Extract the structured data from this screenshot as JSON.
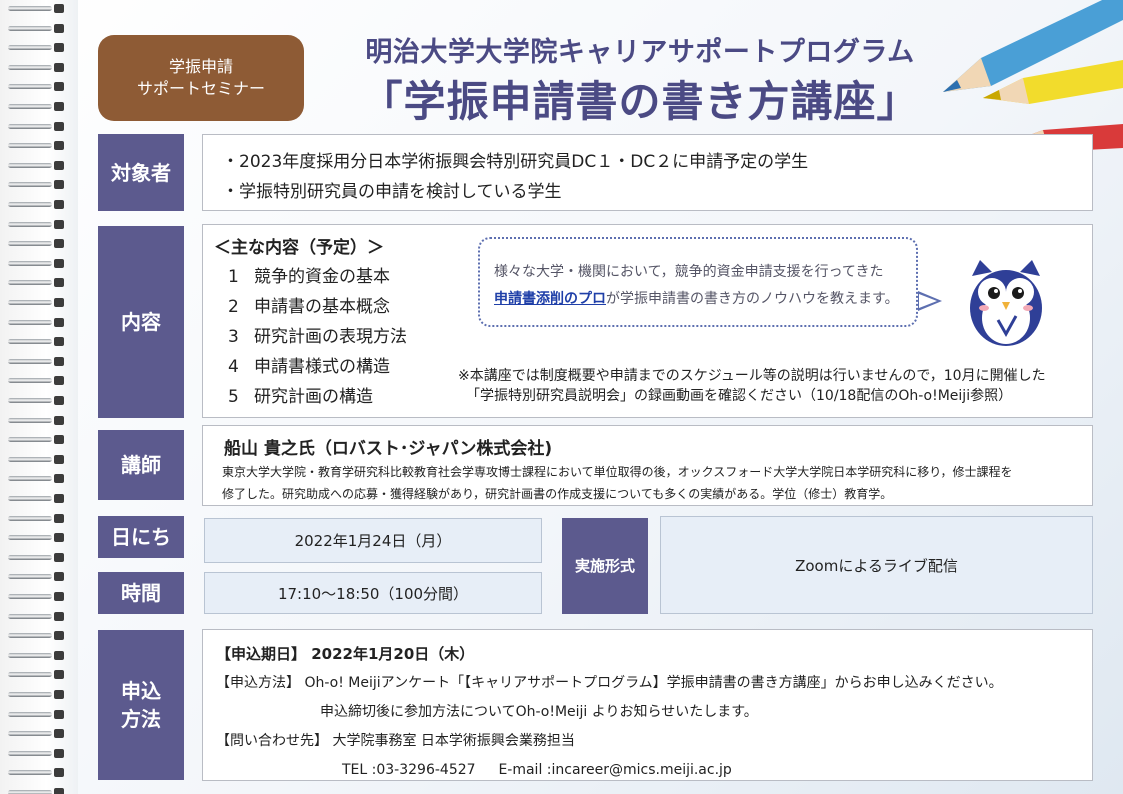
{
  "header": {
    "badge_line1": "学振申請",
    "badge_line2": "サポートセミナー",
    "subtitle": "明治大学大学院キャリアサポートプログラム",
    "title": "「学振申請書の書き方講座」"
  },
  "target": {
    "label": "対象者",
    "lines": [
      "・2023年度採用分日本学術振興会特別研究員DC１・DC２に申請予定の学生",
      "・学振特別研究員の申請を検討している学生"
    ]
  },
  "content": {
    "label": "内容",
    "heading": "＜主な内容（予定）＞",
    "items": [
      {
        "num": "1",
        "text": "競争的資金の基本"
      },
      {
        "num": "2",
        "text": "申請書の基本概念"
      },
      {
        "num": "3",
        "text": "研究計画の表現方法"
      },
      {
        "num": "4",
        "text": "申請書様式の構造"
      },
      {
        "num": "5",
        "text": "研究計画の構造"
      }
    ],
    "bubble_line1": "様々な大学・機関において，競争的資金申請支援を行ってきた",
    "bubble_highlight": "申請書添削のプロ",
    "bubble_line2_rest": "が学振申請書の書き方のノウハウを教えます。",
    "note_line1": "※本講座では制度概要や申請までのスケジュール等の説明は行いませんので，10月に開催した",
    "note_line2": "「学振特別研究員説明会」の録画動画を確認ください（10/18配信のOh-o!Meiji参照）"
  },
  "lecturer": {
    "label": "講師",
    "name": "船山 貴之氏（ロバスト･ジャパン株式会社)",
    "bio_line1": "東京大学大学院・教育学研究科比較教育社会学専攻博士課程において単位取得の後，オックスフォード大学大学院日本学研究科に移り，修士課程を",
    "bio_line2": "修了した。研究助成への応募・獲得経験があり，研究計画書の作成支援についても多くの実績がある。学位（修士）教育学。"
  },
  "schedule": {
    "date_label": "日にち",
    "date_value": "2022年1月24日（月）",
    "time_label": "時間",
    "time_value": "17:10～18:50（100分間）",
    "format_label": "実施形式",
    "format_value": "Zoomによるライブ配信"
  },
  "application": {
    "label_line1": "申込",
    "label_line2": "方法",
    "deadline": "【申込期日】 2022年1月20日（木）",
    "method": "【申込方法】 Oh-o! Meijiアンケート「【キャリアサポートプログラム】学振申請書の書き方講座」からお申し込みください。",
    "method_note": "申込締切後に参加方法についてOh-o!Meiji よりお知らせいたします。",
    "contact": "【問い合わせ先】 大学院事務室 日本学術振興会業務担当",
    "contact_details": "TEL :03-3296-4527 　 E-mail :incareer@mics.meiji.ac.jp"
  },
  "colors": {
    "label_bg": "#5c5a8e",
    "title": "#4b4a84",
    "badge_bg": "#8e5b35",
    "value_box_bg": "#e7eef7"
  }
}
